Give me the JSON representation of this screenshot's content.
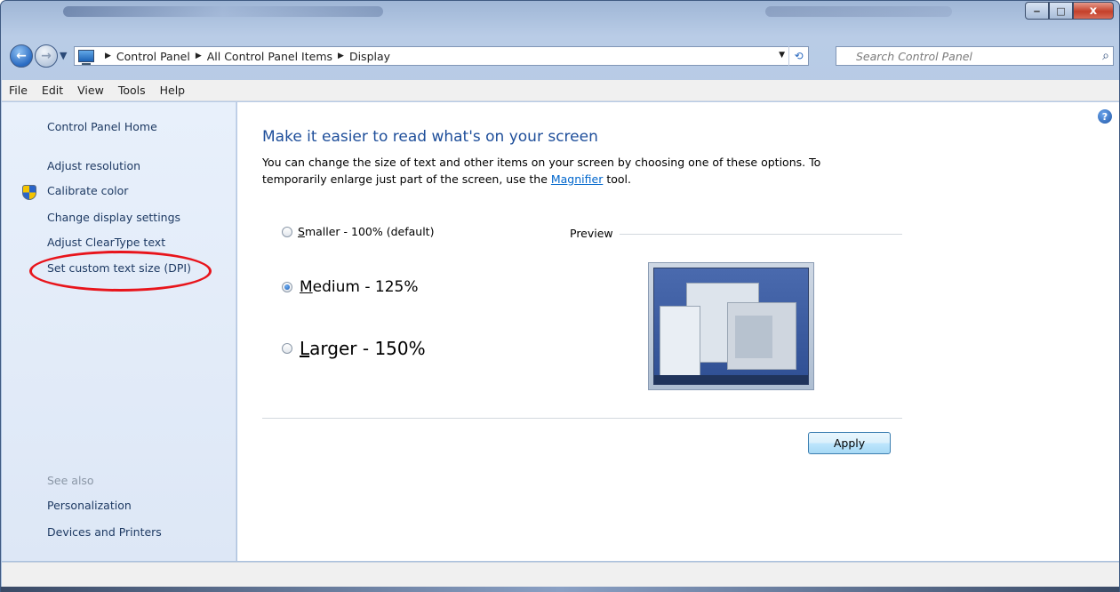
{
  "window": {
    "caption_buttons": {
      "minimize": "‒",
      "maximize": "□",
      "close": "x"
    }
  },
  "navigation": {
    "breadcrumbs": [
      "Control Panel",
      "All Control Panel Items",
      "Display"
    ],
    "search_placeholder": "Search Control Panel",
    "icons": [
      "back-icon",
      "forward-icon",
      "recent-pages-icon",
      "control-panel-icon",
      "refresh-icon",
      "search-icon"
    ]
  },
  "menu": [
    "File",
    "Edit",
    "View",
    "Tools",
    "Help"
  ],
  "sidebar": {
    "home": "Control Panel Home",
    "items": [
      "Adjust resolution",
      "Calibrate color",
      "Change display settings",
      "Adjust ClearType text",
      "Set custom text size (DPI)"
    ],
    "see_also_label": "See also",
    "see_also": [
      "Personalization",
      "Devices and Printers"
    ],
    "highlight_color": "#e8141b"
  },
  "main": {
    "heading": "Make it easier to read what's on your screen",
    "description_before_link": "You can change the size of text and other items on your screen by choosing one of these options. To temporarily enlarge just part of the screen, use the ",
    "link": "Magnifier",
    "description_after_link": " tool.",
    "options": [
      {
        "label_first": "S",
        "label_rest": "maller - 100% (default)",
        "checked": false
      },
      {
        "label_first": "M",
        "label_rest": "edium - 125%",
        "checked": true
      },
      {
        "label_first": "L",
        "label_rest": "arger - 150%",
        "checked": false
      }
    ],
    "preview_label": "Preview",
    "apply_button": "Apply",
    "heading_color": "#1e4e9a",
    "link_color": "#0066cc"
  }
}
